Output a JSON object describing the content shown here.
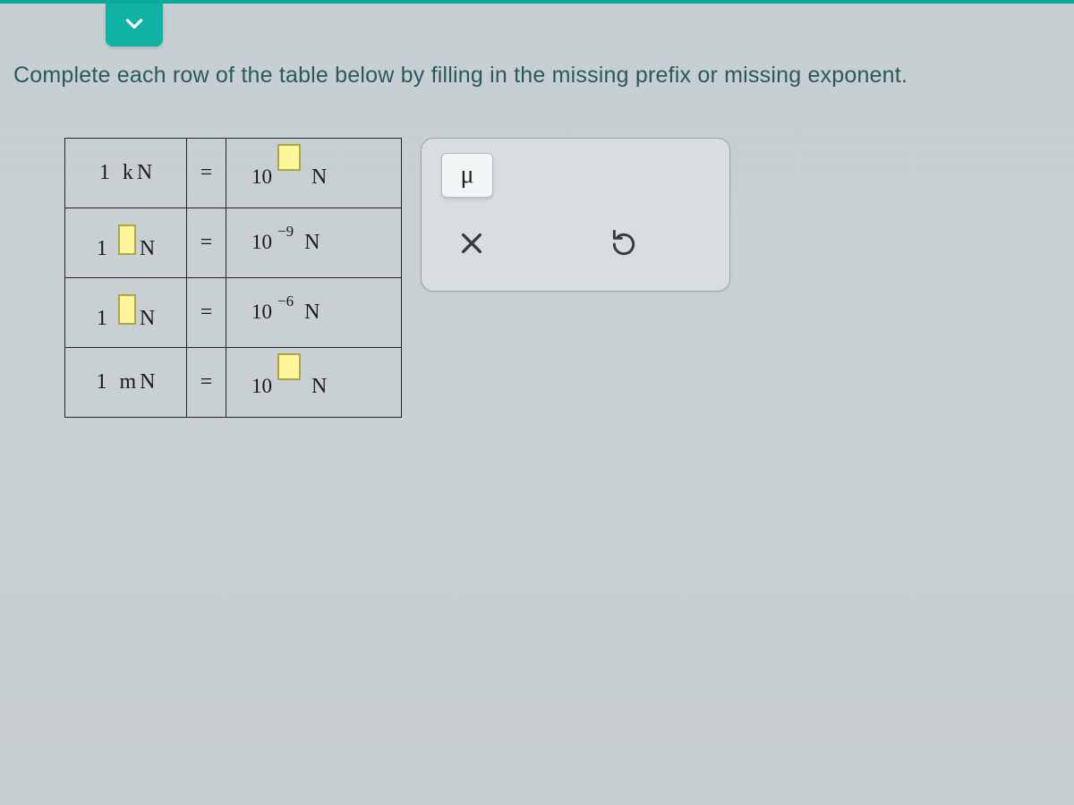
{
  "instruction": "Complete each row of the table below by filling in the missing prefix or missing exponent.",
  "unit": "N",
  "equals": "=",
  "base": "10",
  "rows": [
    {
      "left_num": "1",
      "left_prefix": "k",
      "left_prefix_input": false,
      "right_exp": "",
      "right_exp_input": true
    },
    {
      "left_num": "1",
      "left_prefix": "",
      "left_prefix_input": true,
      "right_exp": "−9",
      "right_exp_input": false
    },
    {
      "left_num": "1",
      "left_prefix": "",
      "left_prefix_input": true,
      "right_exp": "−6",
      "right_exp_input": false
    },
    {
      "left_num": "1",
      "left_prefix": "m",
      "left_prefix_input": false,
      "right_exp": "",
      "right_exp_input": true
    }
  ],
  "palette": {
    "mu": "μ",
    "clear": "×",
    "reset": "↺"
  }
}
